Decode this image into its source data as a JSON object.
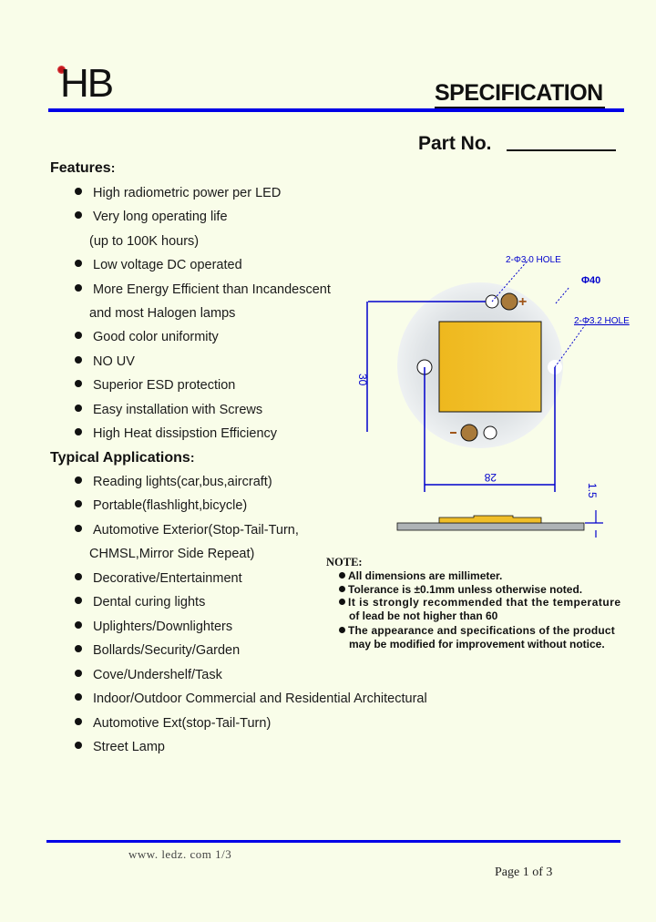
{
  "header": {
    "logo_text": "HB",
    "title": "SPECIFICATION",
    "part_no_label": "Part No."
  },
  "features": {
    "heading": "Features",
    "items": [
      "High radiometric power per LED",
      "Very long operating life",
      "(up to 100K hours)",
      "Low voltage DC operated",
      "More Energy Efficient than Incandescent",
      "and most Halogen lamps",
      "Good color uniformity",
      "NO UV",
      "Superior ESD protection",
      "Easy installation with Screws",
      "High Heat dissipstion Efficiency"
    ]
  },
  "applications": {
    "heading": "Typical Applications",
    "items": [
      "Reading lights(car,bus,aircraft)",
      "Portable(flashlight,bicycle)",
      "Automotive Exterior(Stop-Tail-Turn,",
      "CHMSL,Mirror Side Repeat)",
      "Decorative/Entertainment",
      "Dental curing lights",
      "Uplighters/Downlighters",
      "Bollards/Security/Garden",
      "Cove/Undershelf/Task",
      "Indoor/Outdoor Commercial and Residential Architectural",
      "Automotive Ext(stop-Tail-Turn)",
      "Street Lamp"
    ]
  },
  "drawing": {
    "hole_top_label": "2-Φ3.0  HOLE",
    "diameter_label": "Φ40",
    "hole_side_label": "2-Φ3.2  HOLE",
    "height_dim": "30",
    "width_dim": "28",
    "thickness_dim": "1.5",
    "plus_sign": "+",
    "minus_sign": "-",
    "colors": {
      "dimension_line": "#0000cc",
      "chip": "#f0be28",
      "pad": "#a97a3a",
      "pcb": "#e8ebee",
      "side_base": "#aeb3b6"
    }
  },
  "notes": {
    "heading": "NOTE:",
    "items": [
      "All dimensions are millimeter.",
      "Tolerance is ±0.1mm unless otherwise noted.",
      "It is strongly recommended that the temperature",
      "of lead be not higher than 60",
      "The appearance and specifications of the product",
      "may be modified for improvement without notice."
    ]
  },
  "footer": {
    "url": "www. ledz. com   1/3",
    "page": "Page 1 of 3"
  }
}
